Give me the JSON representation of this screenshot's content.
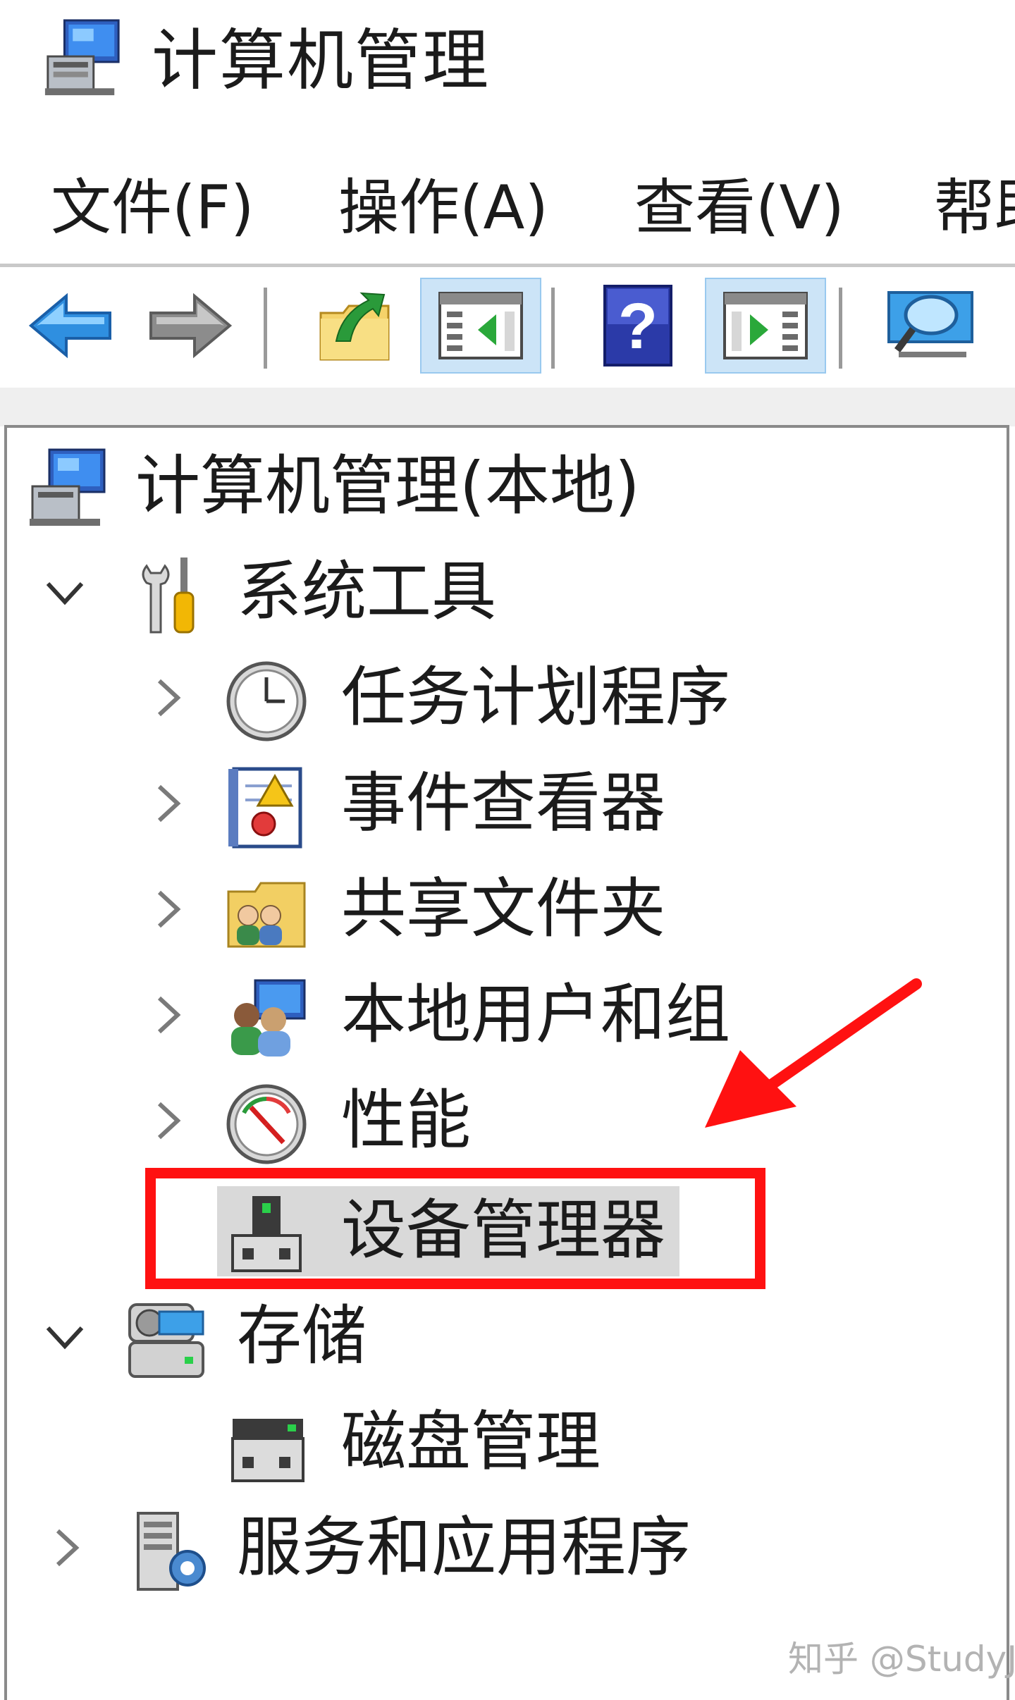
{
  "window": {
    "title": "计算机管理",
    "icon": "computer-management-icon"
  },
  "menu": {
    "items": [
      {
        "label": "文件(F)"
      },
      {
        "label": "操作(A)"
      },
      {
        "label": "查看(V)"
      },
      {
        "label": "帮助"
      }
    ]
  },
  "toolbar": {
    "buttons": [
      {
        "icon": "back-arrow-icon",
        "active": false
      },
      {
        "icon": "forward-arrow-icon",
        "active": false
      },
      {
        "icon": "up-folder-icon",
        "active": false
      },
      {
        "icon": "show-hide-console-tree-icon",
        "active": true
      },
      {
        "icon": "help-icon",
        "active": false
      },
      {
        "icon": "show-hide-action-pane-icon",
        "active": true
      },
      {
        "icon": "monitor-icon",
        "active": false
      }
    ]
  },
  "tree": {
    "root": {
      "label": "计算机管理(本地)",
      "icon": "computer-management-icon"
    },
    "nodes": [
      {
        "label": "系统工具",
        "icon": "tools-icon",
        "expanded": true
      },
      {
        "label": "任务计划程序",
        "icon": "clock-icon",
        "expandable": true
      },
      {
        "label": "事件查看器",
        "icon": "event-viewer-icon",
        "expandable": true
      },
      {
        "label": "共享文件夹",
        "icon": "shared-folder-icon",
        "expandable": true
      },
      {
        "label": "本地用户和组",
        "icon": "users-icon",
        "expandable": true
      },
      {
        "label": "性能",
        "icon": "performance-gauge-icon",
        "expandable": true
      },
      {
        "label": "设备管理器",
        "icon": "device-manager-icon",
        "selected": true
      },
      {
        "label": "存储",
        "icon": "storage-icon",
        "expanded": true
      },
      {
        "label": "磁盘管理",
        "icon": "disk-management-icon"
      },
      {
        "label": "服务和应用程序",
        "icon": "services-icon",
        "expandable": true
      }
    ]
  },
  "annotation": {
    "highlight_color": "#ff1111",
    "arrow_color": "#ff1111"
  },
  "colors": {
    "selection": "#d9d9d9",
    "toolbar_active": "#cce4f7",
    "toolbar_active_border": "#99c9ef"
  },
  "watermark": "知乎 @StudyJ"
}
